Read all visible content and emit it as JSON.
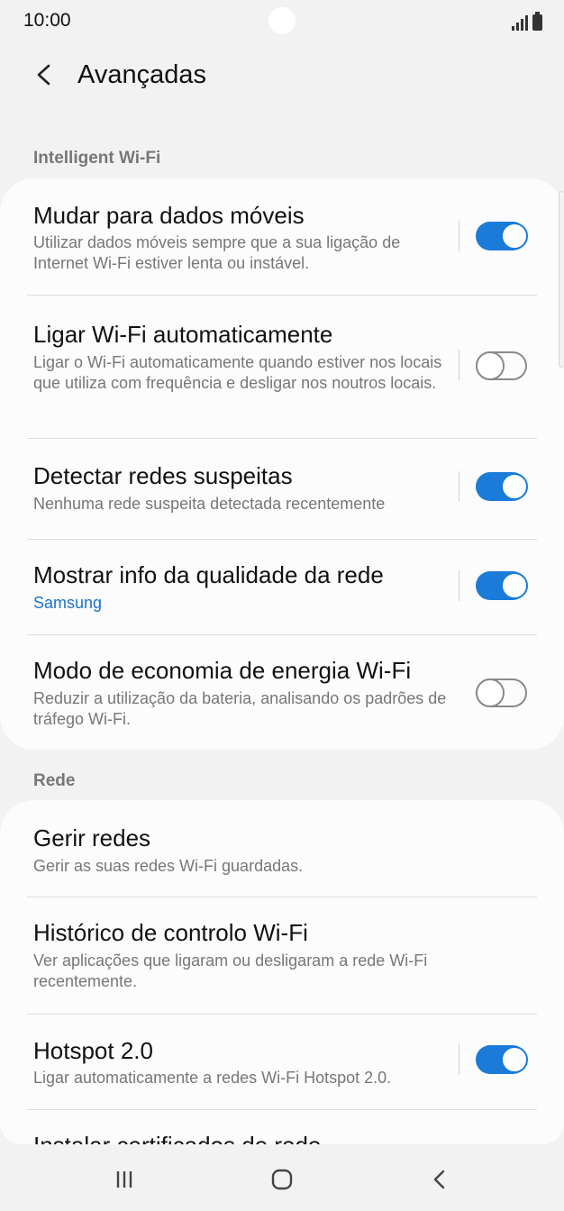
{
  "status_bar": {
    "time": "10:00"
  },
  "header": {
    "title": "Avançadas"
  },
  "sections": [
    {
      "title": "Intelligent Wi-Fi"
    },
    {
      "title": "Rede"
    }
  ],
  "items": [
    {
      "title": "Mudar para dados móveis",
      "subtitle": "Utilizar dados móveis sempre que a sua ligação de Internet Wi-Fi estiver lenta ou instável.",
      "toggle": true
    },
    {
      "title": "Ligar Wi-Fi automaticamente",
      "subtitle": "Ligar o Wi-Fi automaticamente quando estiver nos locais que utiliza com frequência e desligar nos noutros locais.",
      "toggle": false
    },
    {
      "title": "Detectar redes suspeitas",
      "subtitle": "Nenhuma rede suspeita detectada recentemente",
      "toggle": true
    },
    {
      "title": "Mostrar info da qualidade da rede",
      "subtitle": "Samsung",
      "toggle": true
    },
    {
      "title": "Modo de economia de energia Wi-Fi",
      "subtitle": "Reduzir a utilização da bateria, analisando os padrões de tráfego Wi-Fi.",
      "toggle": false
    },
    {
      "title": "Gerir redes",
      "subtitle": "Gerir as suas redes Wi-Fi guardadas."
    },
    {
      "title": "Histórico de controlo Wi-Fi",
      "subtitle": "Ver aplicações que ligaram ou desligaram a rede Wi-Fi recentemente."
    },
    {
      "title": "Hotspot 2.0",
      "subtitle": "Ligar automaticamente a redes Wi-Fi Hotspot 2.0.",
      "toggle": true
    },
    {
      "title": "Instalar certificados de rede"
    }
  ],
  "colors": {
    "accent": "#1a7bd8",
    "link": "#1a73c5",
    "background": "#f2f2f2",
    "card": "#fcfcfc"
  },
  "icons": {
    "back": "chevron-left-icon",
    "recents": "recents-icon",
    "home": "home-icon",
    "nav_back": "back-icon"
  }
}
